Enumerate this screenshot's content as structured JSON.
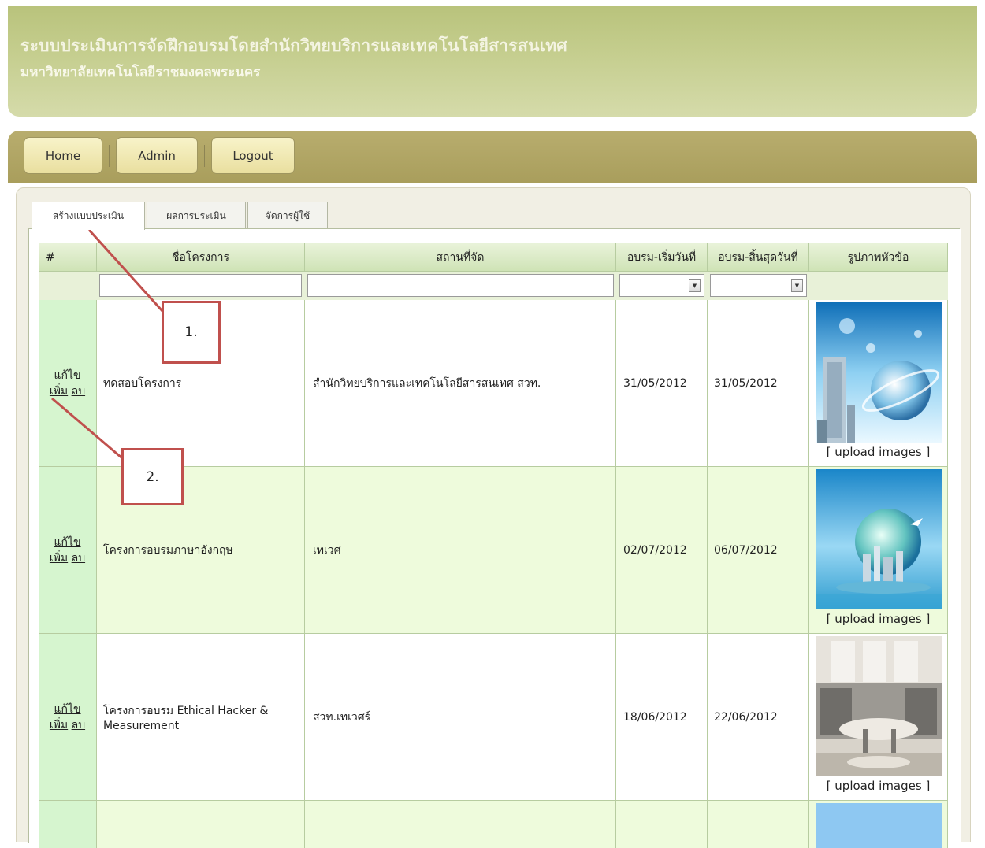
{
  "header": {
    "title": "ระบบประเมินการจัดฝึกอบรมโดยสำนักวิทยบริการและเทคโนโลยีสารสนเทศ",
    "subtitle": "มหาวิทยาลัยเทคโนโลยีราชมงคลพระนคร"
  },
  "nav": {
    "home": "Home",
    "admin": "Admin",
    "logout": "Logout"
  },
  "tabs": [
    {
      "label": "สร้างแบบประเมิน",
      "active": true
    },
    {
      "label": "ผลการประเมิน",
      "active": false
    },
    {
      "label": "จัดการผู้ใช้",
      "active": false
    }
  ],
  "table": {
    "columns": [
      "#",
      "ชื่อโครงการ",
      "สถานที่จัด",
      "อบรม-เริ่มวันที่",
      "อบรม-สิ้นสุดวันที่",
      "รูปภาพหัวข้อ"
    ],
    "actions": {
      "edit": "แก้ไข",
      "add": "เพิ่ม",
      "delete": "ลบ"
    },
    "upload_label": "[ upload images ]",
    "rows": [
      {
        "name": "ทดสอบโครงการ",
        "place": "สำนักวิทยบริการและเทคโนโลยีสารสนเทศ สวท.",
        "start": "31/05/2012",
        "end": "31/05/2012",
        "image": "globe-city-image"
      },
      {
        "name": "โครงการอบรมภาษาอังกฤษ",
        "place": "เทเวศ",
        "start": "02/07/2012",
        "end": "06/07/2012",
        "image": "globe-island-image"
      },
      {
        "name": "โครงการอบรม Ethical Hacker & Measurement",
        "place": "สวท.เทเวศร์",
        "start": "18/06/2012",
        "end": "22/06/2012",
        "image": "office-interior-image"
      }
    ]
  },
  "callouts": {
    "one": "1.",
    "two": "2."
  },
  "colors": {
    "header": "#c4cd8d",
    "navbar": "#b1a664",
    "action_cell": "#d6f5cf",
    "table_header": "#d9ebc4",
    "callout_border": "#c0504d"
  }
}
